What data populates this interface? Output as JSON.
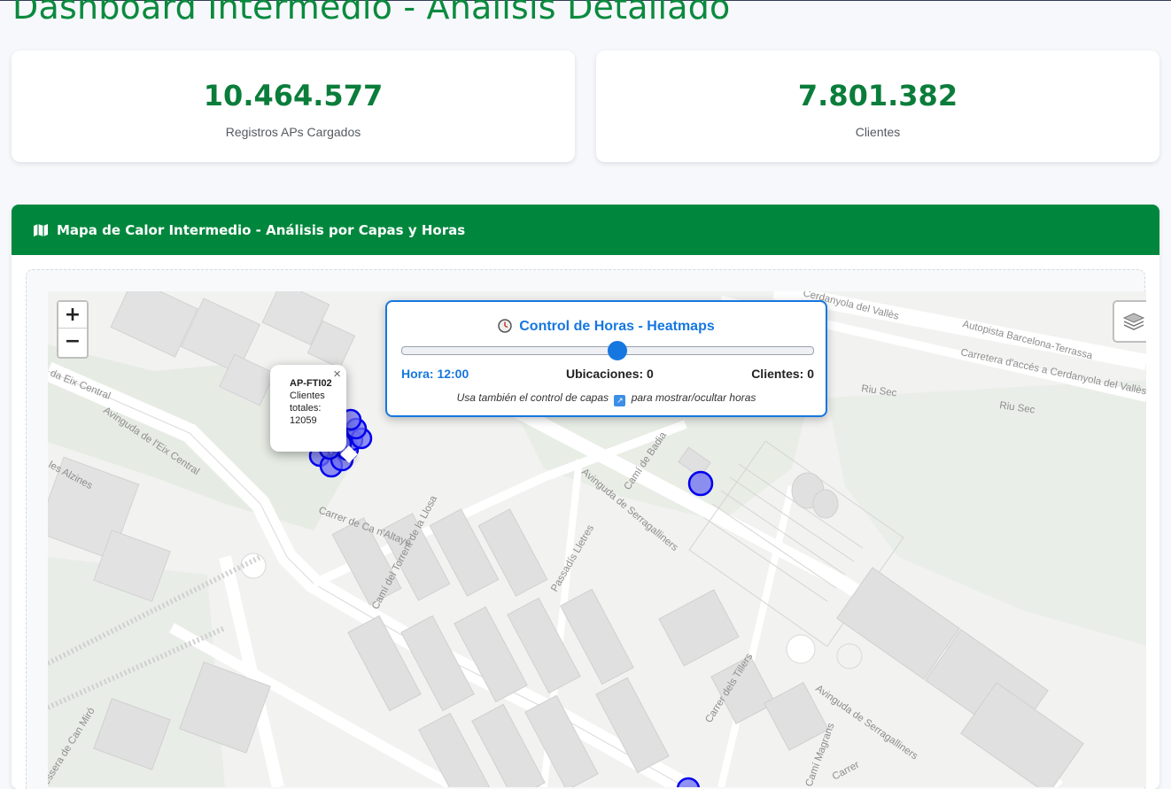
{
  "page": {
    "title": "Dashboard Intermedio - Análisis Detallado"
  },
  "stats": [
    {
      "value": "10.464.577",
      "label": "Registros APs Cargados"
    },
    {
      "value": "7.801.382",
      "label": "Clientes"
    }
  ],
  "panel": {
    "title": "Mapa de Calor Intermedio - Análisis por Capas y Horas",
    "icon": "map-icon"
  },
  "zoom": {
    "in_label": "+",
    "out_label": "−"
  },
  "hour_control": {
    "title": "Control de Horas - Heatmaps",
    "icon": "clock-icon",
    "slider": {
      "min": 0,
      "max": 23,
      "value": 12
    },
    "hora_text": "Hora: 12:00",
    "ubicaciones_text": "Ubicaciones: 0",
    "clientes_text": "Clientes: 0",
    "hint_before": "Usa también el control de capas",
    "hint_after": "para mostrar/ocultar horas"
  },
  "popup": {
    "ap_name": "AP-FTI02",
    "line1": "Clientes",
    "line2": "totales:",
    "value": "12059",
    "close": "×"
  },
  "map_labels": {
    "s1": "Cerdanyola del Vallès",
    "s2": "Autopista Barcelona-Terrassa",
    "s3": "Carretera d'accés a Cerdanyola del Vallès",
    "s4": "Riu Sec",
    "s5": "Riu Sec",
    "s6": "Avinguda de l'Eix Central",
    "s7": "da Eix Central",
    "s8": "Carrer de Ca n'Altayó",
    "s9": "Camí del Torrent de la Llosa",
    "s10": "Avinguda de Serragalliners",
    "s11": "Camí de Badia",
    "s12": "Passadís Lletres",
    "s13": "Carrer dels Tillers",
    "s14": "Avinguda de Serragalliners",
    "s15": "Camí Magrans",
    "s16": "les Alzines",
    "s17": "essera de Can Miró",
    "s18": "Carrer"
  },
  "colors": {
    "brand_green": "#00873d",
    "accent_blue": "#1677e0",
    "marker": "#0000ee"
  }
}
